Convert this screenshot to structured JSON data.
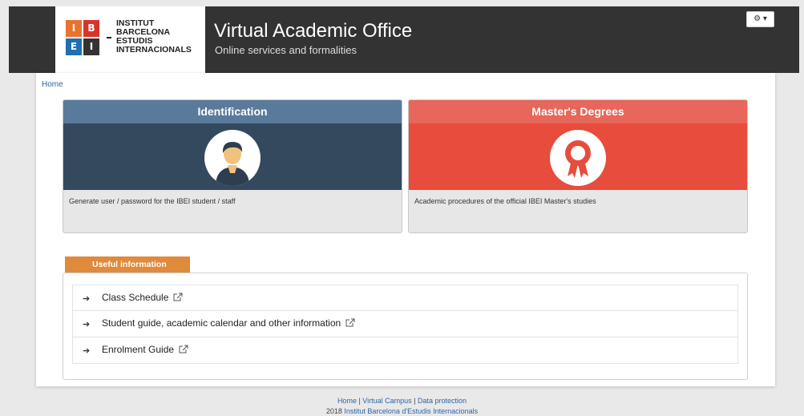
{
  "header": {
    "logo": {
      "letters": [
        "I",
        "B",
        "E",
        "I"
      ],
      "colors": [
        "#e8732e",
        "#d9342b",
        "#1f6fb5",
        "#333333"
      ],
      "text_lines": [
        "INSTITUT",
        "BARCELONA",
        "ESTUDIS",
        "INTERNACIONALS"
      ]
    },
    "title": "Virtual Academic Office",
    "subtitle": "Online services and formalities",
    "gear_button": "⚙ ▾"
  },
  "breadcrumb": {
    "home": "Home"
  },
  "cards": [
    {
      "title": "Identification",
      "description": "Generate user / password for the IBEI student / staff",
      "header_color": "#5a7a9c",
      "banner_color": "#34495e",
      "icon": "student-avatar-icon"
    },
    {
      "title": "Master's Degrees",
      "description": "Academic procedures of the official IBEI Master's studies",
      "header_color": "#e8665a",
      "banner_color": "#e74c3c",
      "icon": "award-ribbon-icon"
    }
  ],
  "useful": {
    "tab_label": "Useful information",
    "tab_color": "#e08a3c",
    "items": [
      {
        "label": "Class Schedule"
      },
      {
        "label": "Student guide, academic calendar and other information"
      },
      {
        "label": "Enrolment Guide"
      }
    ]
  },
  "footer": {
    "links": [
      "Home",
      "Virtual Campus",
      "Data protection"
    ],
    "separator": " | ",
    "year": "2018",
    "institution": "Institut Barcelona d'Estudis Internacionals"
  }
}
